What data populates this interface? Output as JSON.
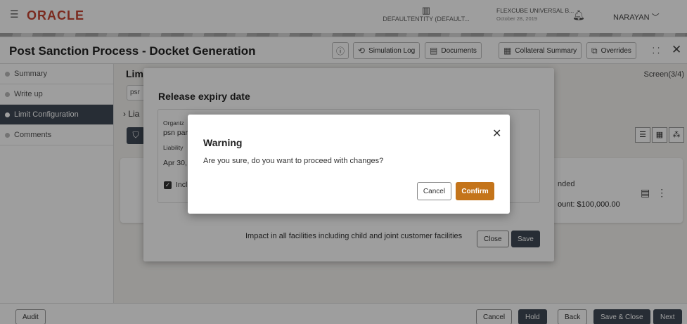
{
  "header": {
    "brand": "ORACLE",
    "entity": "DEFAULTENTITY (DEFAULT...",
    "app_name": "FLEXCUBE UNIVERSAL B...",
    "app_date": "October 28, 2019",
    "user": "NARAYAN"
  },
  "titlebar": {
    "title": "Post Sanction Process - Docket Generation",
    "buttons": {
      "info": "ⓘ",
      "simulation_log": "Simulation Log",
      "documents": "Documents",
      "collateral_summary": "Collateral Summary",
      "overrides": "Overrides"
    }
  },
  "sidebar": {
    "items": [
      {
        "label": "Summary"
      },
      {
        "label": "Write up"
      },
      {
        "label": "Limit Configuration"
      },
      {
        "label": "Comments"
      }
    ]
  },
  "main": {
    "heading": "Lim",
    "screen": "Screen(3/4)",
    "chip": "psr",
    "liability_toggle": "Lia",
    "card": {
      "status": "nded",
      "amount_label": "ount:",
      "amount_value": "$100,000.00"
    }
  },
  "release_dialog": {
    "title": "Release expiry date",
    "org_label": "Organiz",
    "org_value": "psn par",
    "liability_label": "Liability",
    "date_value": "Apr 30,",
    "checkbox_label": "Inclu",
    "impact_text": "Impact in all facilities including child and joint customer facilities",
    "close": "Close",
    "save": "Save"
  },
  "warning_dialog": {
    "title": "Warning",
    "message": "Are you sure, do you want to proceed with changes?",
    "cancel": "Cancel",
    "confirm": "Confirm"
  },
  "footer": {
    "audit": "Audit",
    "cancel": "Cancel",
    "hold": "Hold",
    "back": "Back",
    "save_close": "Save & Close",
    "next": "Next"
  },
  "colors": {
    "brand": "#c74634",
    "dark_button": "#3f4a56",
    "confirm": "#c4741a"
  }
}
